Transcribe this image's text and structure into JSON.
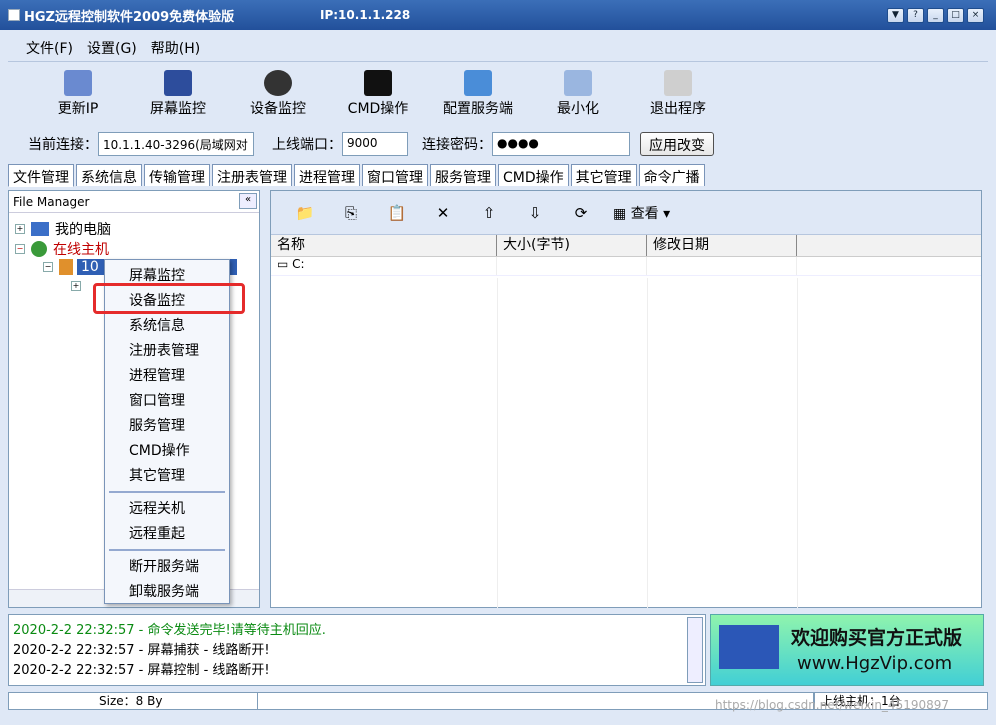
{
  "window": {
    "title": "HGZ远程控制软件2009免费体验版",
    "ip": "IP:10.1.1.228"
  },
  "menu": [
    "文件(F)",
    "设置(G)",
    "帮助(H)"
  ],
  "toolbar": [
    "更新IP",
    "屏幕监控",
    "设备监控",
    "CMD操作",
    "配置服务端",
    "最小化",
    "退出程序"
  ],
  "connection": {
    "current_label": "当前连接：",
    "current_value": "10.1.1.40-3296(局域网对",
    "port_label": "上线端口：",
    "port_value": "9000",
    "password_label": "连接密码：",
    "password_value": "●●●●",
    "apply": "应用改变"
  },
  "tabs": [
    "文件管理",
    "系统信息",
    "传输管理",
    "注册表管理",
    "进程管理",
    "窗口管理",
    "服务管理",
    "CMD操作",
    "其它管理",
    "命令广播"
  ],
  "left_pane": {
    "header": "File Manager",
    "collapse": "«",
    "tree": [
      "我的电脑",
      "在线主机",
      "10"
    ]
  },
  "right_toolbar": {
    "view": "查看"
  },
  "file_list": {
    "columns": [
      "名称",
      "大小(字节)",
      "修改日期",
      ""
    ],
    "rows": [
      {
        "name": "C:"
      }
    ]
  },
  "context_menu": {
    "items": [
      "屏幕监控",
      "设备监控",
      "系统信息",
      "注册表管理",
      "进程管理",
      "窗口管理",
      "服务管理",
      "CMD操作",
      "其它管理",
      "远程关机",
      "远程重起",
      "断开服务端",
      "卸载服务端"
    ]
  },
  "log": [
    "2020-2-2 22:32:57 - 命令发送完毕!请等待主机回应.",
    "2020-2-2 22:32:57 - 屏幕捕获 - 线路断开!",
    "2020-2-2 22:32:57 - 屏幕控制 - 线路断开!"
  ],
  "ad": {
    "line1": "欢迎购买官方正式版",
    "line2": "www.HgzVip.com"
  },
  "status": {
    "size": "Size：8 By",
    "online": "上线主机：1台"
  },
  "watermark": "https://blog.csdn.net/weixin_45190897",
  "colors": {
    "title": "#22509b",
    "highlight": "#e52b2b",
    "log_green": "#0a8a12",
    "online_red": "#c00000"
  }
}
